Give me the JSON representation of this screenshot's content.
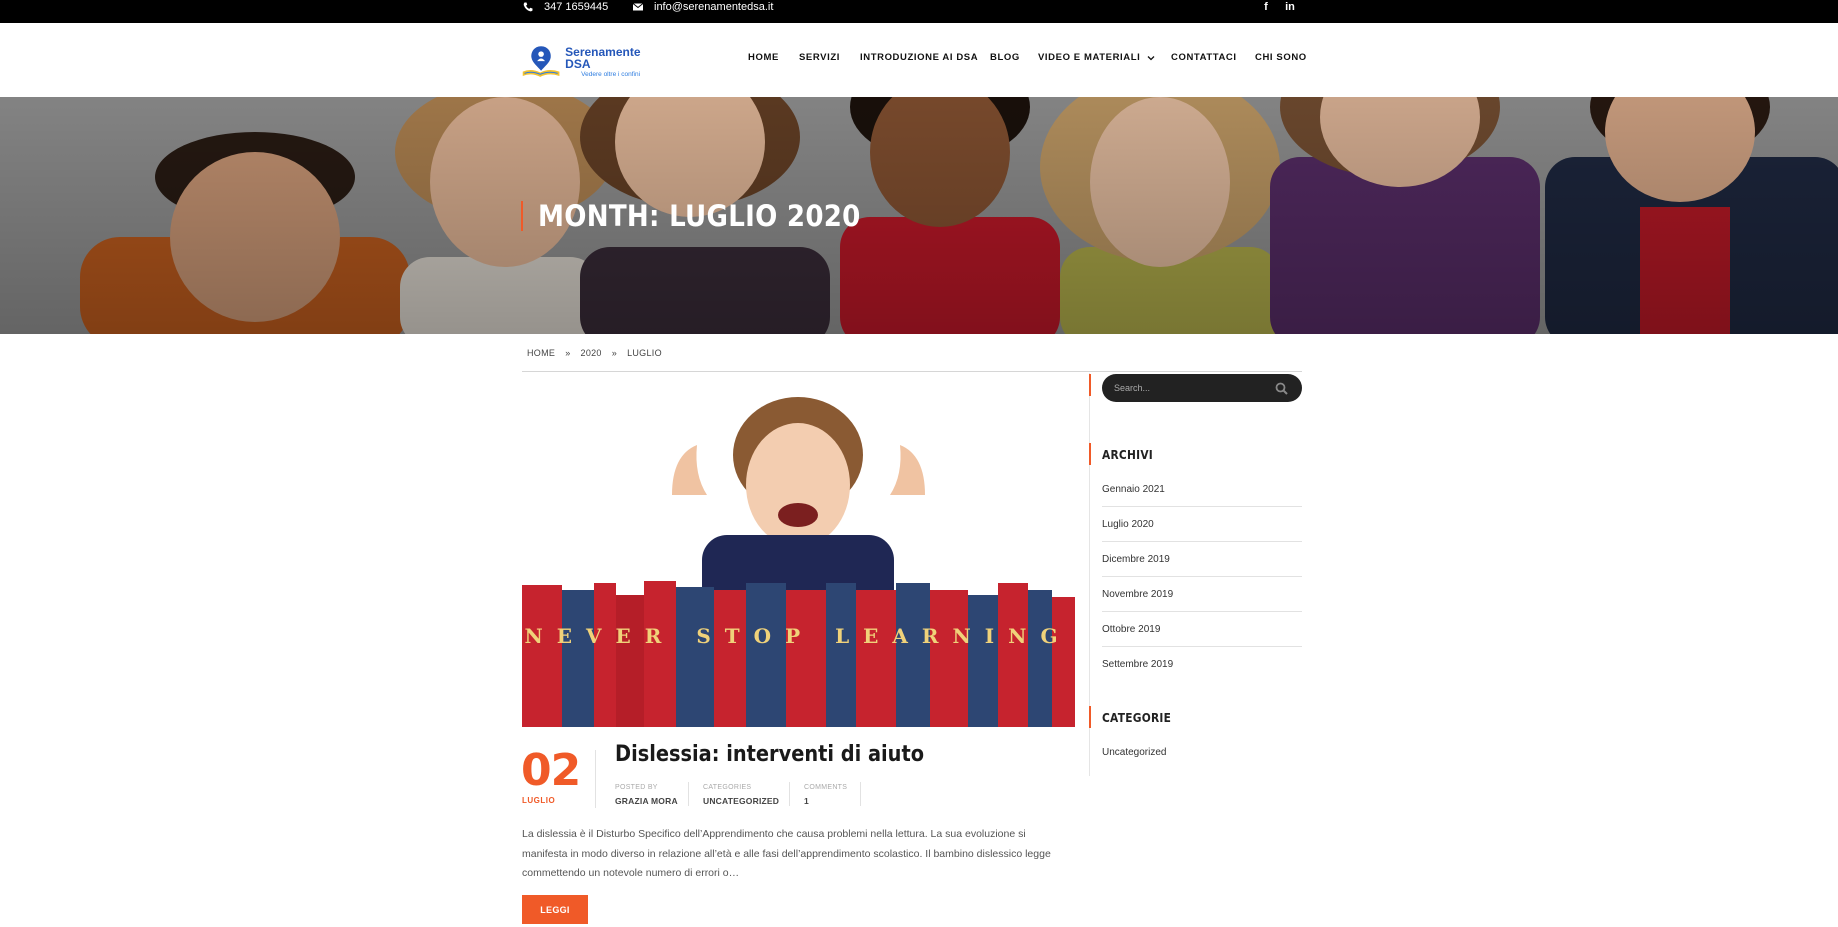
{
  "topbar": {
    "phone": "347 1659445",
    "email": "info@serenamentedsa.it",
    "social": [
      "f",
      "in"
    ]
  },
  "header": {
    "logo_title": "Serenamente DSA",
    "logo_tagline": "Vedere oltre i confini",
    "nav": [
      {
        "label": "HOME",
        "has_dropdown": false
      },
      {
        "label": "SERVIZI",
        "has_dropdown": false
      },
      {
        "label": "INTRODUZIONE AI DSA",
        "has_dropdown": false
      },
      {
        "label": "BLOG",
        "has_dropdown": false
      },
      {
        "label": "VIDEO E MATERIALI",
        "has_dropdown": true
      },
      {
        "label": "CONTATTACI",
        "has_dropdown": false
      },
      {
        "label": "CHI SONO",
        "has_dropdown": false
      }
    ]
  },
  "hero": {
    "title": "MONTH: LUGLIO 2020"
  },
  "breadcrumb": {
    "items": [
      "HOME",
      "2020",
      "LUGLIO"
    ],
    "separator": "»"
  },
  "post": {
    "image_text": "NEVER STOP LEARNING",
    "day": "02",
    "month": "LUGLIO",
    "title": "Dislessia: interventi di aiuto",
    "meta": [
      {
        "label": "POSTED BY",
        "value": "GRAZIA MORA"
      },
      {
        "label": "CATEGORIES",
        "value": "UNCATEGORIZED"
      },
      {
        "label": "COMMENTS",
        "value": "1"
      }
    ],
    "excerpt": "La dislessia è il Disturbo Specifico dell’Apprendimento che causa problemi nella lettura. La sua evoluzione si manifesta in modo diverso in relazione all’età e alle fasi dell’apprendimento scolastico. Il bambino dislessico legge commettendo un notevole numero di errori o…",
    "read_more": "LEGGI"
  },
  "sidebar": {
    "search_placeholder": "Search...",
    "archives_title": "ARCHIVI",
    "archives": [
      "Gennaio 2021",
      "Luglio 2020",
      "Dicembre 2019",
      "Novembre 2019",
      "Ottobre 2019",
      "Settembre 2019"
    ],
    "categories_title": "CATEGORIE",
    "categories": [
      "Uncategorized"
    ]
  },
  "colors": {
    "accent": "#f05a28",
    "topbar": "#000000",
    "logo_blue": "#2557b9"
  }
}
